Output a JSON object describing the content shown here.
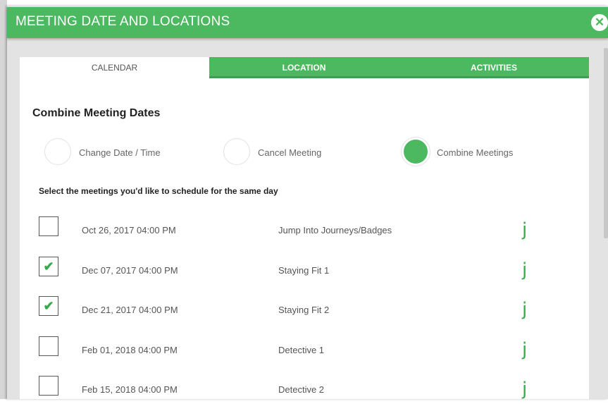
{
  "dialog": {
    "title": "MEETING DATE AND LOCATIONS",
    "close_glyph": "✕"
  },
  "tabs": [
    {
      "label": "CALENDAR",
      "active": true
    },
    {
      "label": "LOCATION",
      "active": false
    },
    {
      "label": "ACTIVITIES",
      "active": false
    }
  ],
  "section_heading": "Combine Meeting Dates",
  "options": [
    {
      "label": "Change Date / Time",
      "selected": false
    },
    {
      "label": "Cancel Meeting",
      "selected": false
    },
    {
      "label": "Combine Meetings",
      "selected": true
    }
  ],
  "instruction": "Select the meetings you'd like to schedule for the same day",
  "meetings": [
    {
      "date": "Oct 26, 2017 04:00 PM",
      "name": "Jump Into Journeys/Badges",
      "checked": false,
      "icon": "j"
    },
    {
      "date": "Dec 07, 2017 04:00 PM",
      "name": "Staying Fit 1",
      "checked": true,
      "icon": "j"
    },
    {
      "date": "Dec 21, 2017 04:00 PM",
      "name": "Staying Fit 2",
      "checked": true,
      "icon": "j"
    },
    {
      "date": "Feb 01, 2018 04:00 PM",
      "name": "Detective 1",
      "checked": false,
      "icon": "j"
    },
    {
      "date": "Feb 15, 2018 04:00 PM",
      "name": "Detective 2",
      "checked": false,
      "icon": "j"
    }
  ],
  "check_glyph": "✔",
  "colors": {
    "accent": "#4cb860",
    "check": "#3aa84e"
  }
}
